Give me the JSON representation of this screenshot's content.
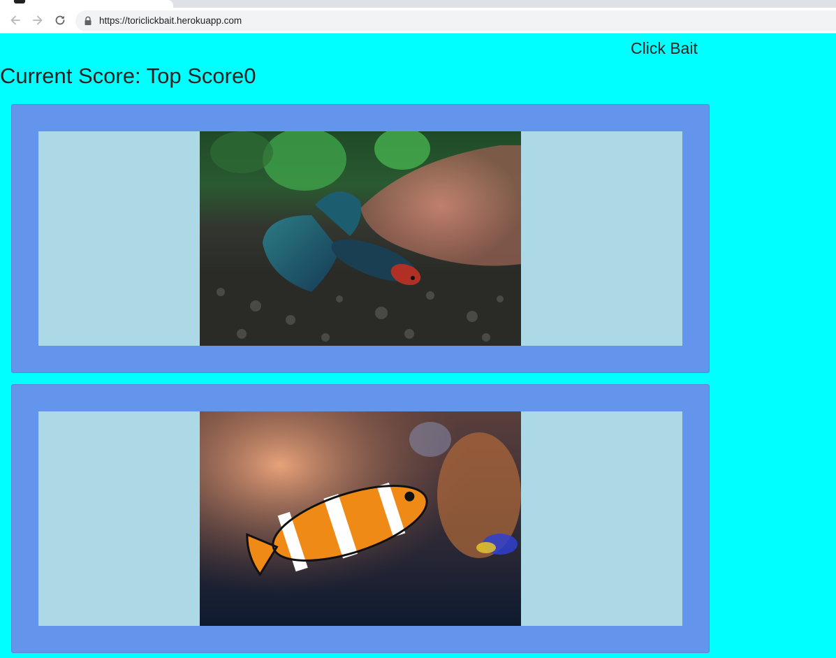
{
  "browser": {
    "url": "https://toriclickbait.herokuapp.com"
  },
  "navbar": {
    "brand": "Click Bait"
  },
  "scoreboard": {
    "text": "Current Score: Top Score0"
  },
  "cards": [
    {
      "image_subject": "betta-fish"
    },
    {
      "image_subject": "clownfish"
    }
  ],
  "colors": {
    "page_background": "#00ffff",
    "card_background": "#6495ed",
    "image_frame": "#add8e6"
  }
}
